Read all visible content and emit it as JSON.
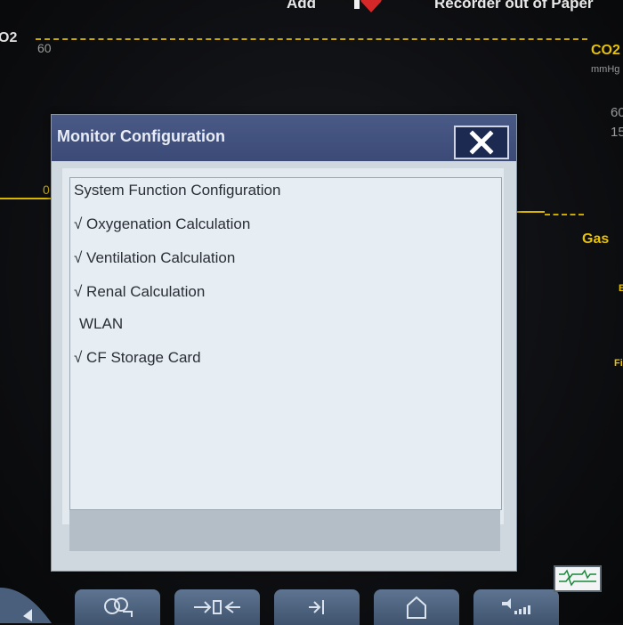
{
  "background": {
    "top_left_label": "Add",
    "top_right_status": "Recorder out of Paper",
    "left_wave_label": "O2",
    "left_scale_top": "60",
    "left_scale_zero": "0",
    "right_wave_label": "CO2",
    "right_unit": "mmHg",
    "right_values": [
      "60",
      "15"
    ],
    "gas_label": "Gas",
    "right_edge_letters": [
      "E",
      "Fi"
    ]
  },
  "dialog": {
    "title": "Monitor Configuration",
    "items": [
      "System Function Configuration",
      "√ Oxygenation Calculation",
      "√ Ventilation Calculation",
      "√ Renal Calculation",
      "WLAN",
      "√ CF Storage Card"
    ]
  },
  "colors": {
    "title_bar": "#3b4a76",
    "waveform": "#d8b600",
    "dialog_body": "#e2eaf0"
  },
  "toolbar": {
    "icons": [
      "left-arrow-icon",
      "printer-icon",
      "input-arrow-icon",
      "jump-icon",
      "home-icon",
      "volume-icon",
      "monitor-waveform-icon"
    ]
  }
}
